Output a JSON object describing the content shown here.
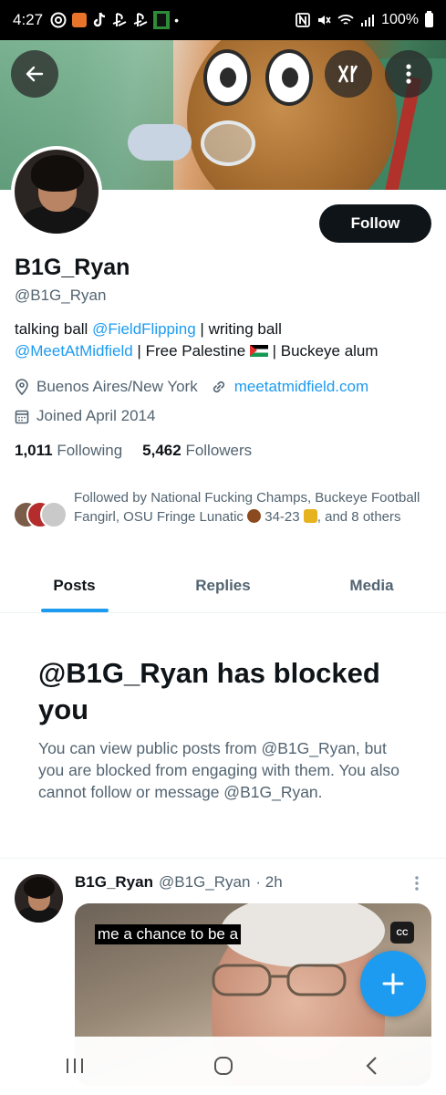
{
  "status_bar": {
    "time": "4:27",
    "battery": "100%"
  },
  "header": {
    "back_icon": "arrow-left-icon",
    "grok_icon": "grok-logo-icon",
    "more_icon": "vertical-dots-icon"
  },
  "profile": {
    "display_name": "B1G_Ryan",
    "handle": "@B1G_Ryan",
    "follow_label": "Follow",
    "bio": {
      "part1": "talking ball ",
      "link1": "@FieldFlipping",
      "part2": " | writing ball ",
      "link2": "@MeetAtMidfield",
      "part3": " | Free Palestine ",
      "part4": " | Buckeye alum"
    },
    "location": "Buenos Aires/New York",
    "website": "meetatmidfield.com",
    "joined": "Joined April 2014",
    "following_count": "1,011",
    "following_label": "Following",
    "followers_count": "5,462",
    "followers_label": "Followers",
    "followed_by": {
      "part1": "Followed by National Fucking Champs, Buckeye Football Fangirl, OSU Fringe Lunatic ",
      "part2": " 34-23 ",
      "part3": ", and 8 others"
    }
  },
  "tabs": [
    {
      "label": "Posts",
      "active": true
    },
    {
      "label": "Replies",
      "active": false
    },
    {
      "label": "Media",
      "active": false
    }
  ],
  "blocked": {
    "title": "@B1G_Ryan has blocked you",
    "message": "You can view public posts from @B1G_Ryan, but you are blocked from engaging with them. You also cannot follow or message @B1G_Ryan."
  },
  "post": {
    "author": "B1G_Ryan",
    "handle": "@B1G_Ryan",
    "time": "· 2h",
    "caption": "me a chance to be a",
    "cc_label": "CC"
  },
  "colors": {
    "accent": "#1d9bf0",
    "text": "#0f1419",
    "muted": "#536471"
  }
}
